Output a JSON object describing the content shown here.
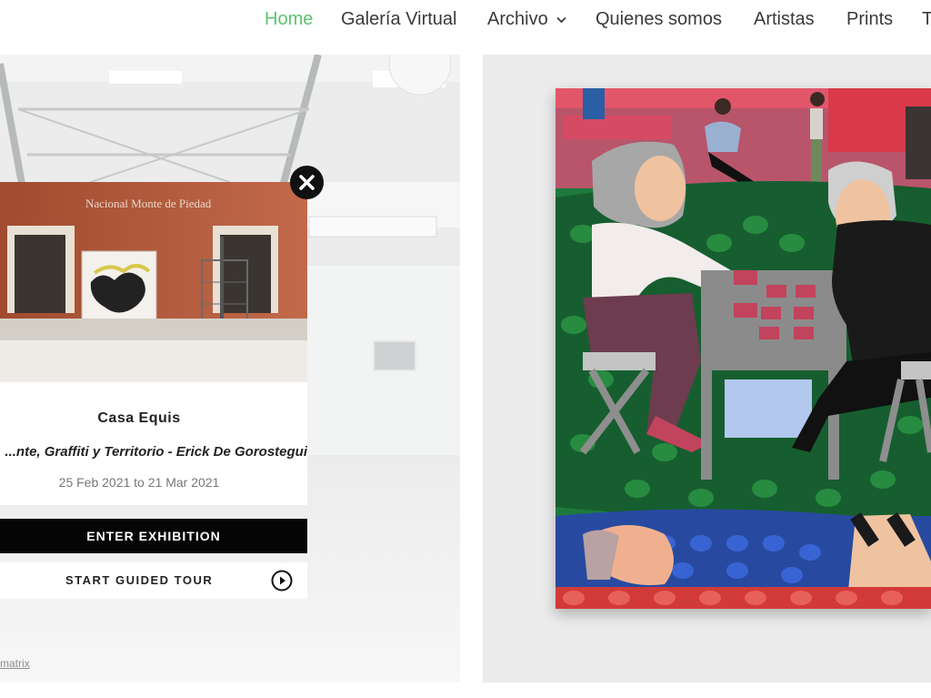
{
  "nav": {
    "items": [
      {
        "label": "Home",
        "active": true
      },
      {
        "label": "Galería Virtual",
        "active": false
      },
      {
        "label": "Archivo",
        "active": false,
        "has_dropdown": true
      },
      {
        "label": "Quienes somos",
        "active": false
      },
      {
        "label": "Artistas",
        "active": false
      },
      {
        "label": "Prints",
        "active": false
      },
      {
        "label": "T",
        "active": false
      }
    ],
    "active_color": "#5cc46e"
  },
  "exhibition": {
    "image_sign": "Nacional Monte de Piedad",
    "title": "Casa Equis",
    "subtitle": "...nte, Graffiti y Territorio - Erick De Gorostegui",
    "dates": "25 Feb 2021 to 21 Mar 2021",
    "enter_label": "ENTER EXHIBITION",
    "guided_label": "START GUIDED TOUR",
    "close_icon": "close-icon",
    "play_icon": "play-circle-icon"
  },
  "footer": {
    "matrix_link": "matrix"
  }
}
